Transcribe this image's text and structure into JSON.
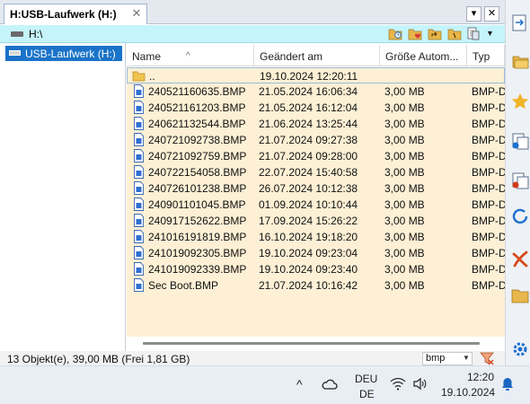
{
  "tab": {
    "title": "H:USB-Laufwerk (H:)",
    "close_glyph": "✕"
  },
  "window_controls": {
    "dropdown_glyph": "▾",
    "close_glyph": "✕"
  },
  "address": {
    "path": "H:\\"
  },
  "tree": {
    "selected_label": "USB-Laufwerk (H:)"
  },
  "columns": {
    "name": "Name",
    "modified": "Geändert am",
    "size": "Größe Autom...",
    "type": "Typ"
  },
  "files": [
    {
      "name": "..",
      "modified": "19.10.2024 12:20:11",
      "size": "",
      "type": "",
      "icon": "folder-up-icon"
    },
    {
      "name": "240521160635.BMP",
      "modified": "21.05.2024 16:06:34",
      "size": "3,00 MB",
      "type": "BMP-D",
      "icon": "file-icon"
    },
    {
      "name": "240521161203.BMP",
      "modified": "21.05.2024 16:12:04",
      "size": "3,00 MB",
      "type": "BMP-D",
      "icon": "file-icon"
    },
    {
      "name": "240621132544.BMP",
      "modified": "21.06.2024 13:25:44",
      "size": "3,00 MB",
      "type": "BMP-D",
      "icon": "file-icon"
    },
    {
      "name": "240721092738.BMP",
      "modified": "21.07.2024 09:27:38",
      "size": "3,00 MB",
      "type": "BMP-D",
      "icon": "file-icon"
    },
    {
      "name": "240721092759.BMP",
      "modified": "21.07.2024 09:28:00",
      "size": "3,00 MB",
      "type": "BMP-D",
      "icon": "file-icon"
    },
    {
      "name": "240722154058.BMP",
      "modified": "22.07.2024 15:40:58",
      "size": "3,00 MB",
      "type": "BMP-D",
      "icon": "file-icon"
    },
    {
      "name": "240726101238.BMP",
      "modified": "26.07.2024 10:12:38",
      "size": "3,00 MB",
      "type": "BMP-D",
      "icon": "file-icon"
    },
    {
      "name": "240901101045.BMP",
      "modified": "01.09.2024 10:10:44",
      "size": "3,00 MB",
      "type": "BMP-D",
      "icon": "file-icon"
    },
    {
      "name": "240917152622.BMP",
      "modified": "17.09.2024 15:26:22",
      "size": "3,00 MB",
      "type": "BMP-D",
      "icon": "file-icon"
    },
    {
      "name": "241016191819.BMP",
      "modified": "16.10.2024 19:18:20",
      "size": "3,00 MB",
      "type": "BMP-D",
      "icon": "file-icon"
    },
    {
      "name": "241019092305.BMP",
      "modified": "19.10.2024 09:23:04",
      "size": "3,00 MB",
      "type": "BMP-D",
      "icon": "file-icon"
    },
    {
      "name": "241019092339.BMP",
      "modified": "19.10.2024 09:23:40",
      "size": "3,00 MB",
      "type": "BMP-D",
      "icon": "file-icon"
    },
    {
      "name": "Sec Boot.BMP",
      "modified": "21.07.2024 10:16:42",
      "size": "3,00 MB",
      "type": "BMP-D",
      "icon": "file-icon"
    }
  ],
  "status": {
    "text": "13 Objekt(e), 39,00 MB   (Frei 1,81 GB)",
    "filter_value": "bmp"
  },
  "taskbar": {
    "chevron": "^",
    "lang_line1": "DEU",
    "lang_line2": "DE",
    "time": "12:20",
    "date": "19.10.2024"
  },
  "colors": {
    "accent": "#1a73c8",
    "row_bg": "#fdf0d5",
    "address_bg": "#c5f4fa"
  }
}
